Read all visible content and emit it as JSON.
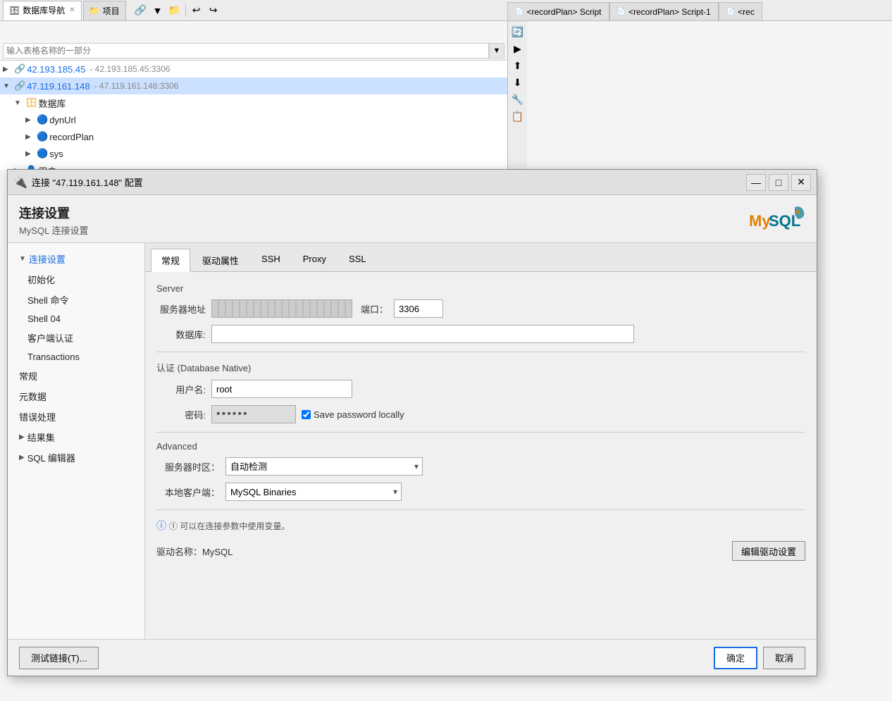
{
  "background": {
    "title": "数据库导航",
    "tabs": [
      {
        "label": "数据库导航",
        "icon": "db"
      },
      {
        "label": "项目",
        "icon": "project"
      }
    ],
    "search_placeholder": "输入表格名称的一部分",
    "tree_items": [
      {
        "id": "t1",
        "indent": 0,
        "arrow": "▶",
        "icon": "🔗",
        "text": "42.193.185.45",
        "sub": "- 42.193.185.45:3306",
        "selected": false
      },
      {
        "id": "t2",
        "indent": 0,
        "arrow": "▼",
        "icon": "🔗",
        "text": "47.119.161.148",
        "sub": "- 47.119.161.148:3306",
        "selected": true
      },
      {
        "id": "t3",
        "indent": 1,
        "arrow": "▼",
        "icon": "🗄",
        "text": "数据库",
        "sub": "",
        "selected": false
      },
      {
        "id": "t4",
        "indent": 2,
        "arrow": "▶",
        "icon": "📂",
        "text": "dynUrl",
        "sub": "",
        "selected": false
      },
      {
        "id": "t5",
        "indent": 2,
        "arrow": "▶",
        "icon": "📂",
        "text": "recordPlan",
        "sub": "",
        "selected": false
      },
      {
        "id": "t6",
        "indent": 2,
        "arrow": "▶",
        "icon": "📂",
        "text": "sys",
        "sub": "",
        "selected": false
      },
      {
        "id": "t7",
        "indent": 1,
        "arrow": "▶",
        "icon": "👤",
        "text": "用户",
        "sub": "",
        "selected": false
      }
    ],
    "script_tabs": [
      {
        "label": "<recordPlan> Script"
      },
      {
        "label": "<recordPlan> Script-1"
      },
      {
        "label": "<rec"
      }
    ]
  },
  "dialog": {
    "title": "连接 \"47.119.161.148\" 配置",
    "title_icon": "🔌",
    "header_title": "连接设置",
    "header_sub": "MySQL 连接设置",
    "mysql_logo": "MySQL",
    "nav_items": [
      {
        "label": "连接设置",
        "indent": 0,
        "arrow": "▼",
        "selected": true,
        "parent": true
      },
      {
        "label": "初始化",
        "indent": 1,
        "selected": false
      },
      {
        "label": "Shell 命令",
        "indent": 1,
        "selected": false
      },
      {
        "label": "Shell 04",
        "indent": 1,
        "selected": false
      },
      {
        "label": "客户端认证",
        "indent": 1,
        "selected": false
      },
      {
        "label": "Transactions",
        "indent": 1,
        "selected": false
      },
      {
        "label": "常规",
        "indent": 0,
        "selected": false
      },
      {
        "label": "元数据",
        "indent": 0,
        "selected": false
      },
      {
        "label": "错误处理",
        "indent": 0,
        "selected": false
      },
      {
        "label": "结果集",
        "indent": 0,
        "arrow": "▶",
        "parent": true,
        "selected": false
      },
      {
        "label": "SQL 编辑器",
        "indent": 0,
        "arrow": "▶",
        "parent": true,
        "selected": false
      }
    ],
    "tabs": [
      {
        "label": "常规",
        "active": true
      },
      {
        "label": "驱动属性",
        "active": false
      },
      {
        "label": "SSH",
        "active": false
      },
      {
        "label": "Proxy",
        "active": false
      },
      {
        "label": "SSL",
        "active": false
      }
    ],
    "server_section": "Server",
    "server_host_label": "服务器地址",
    "server_host_value": "",
    "server_port_label": "端口：",
    "server_port_value": "3306",
    "database_label": "数据库:",
    "database_value": "",
    "auth_section": "认证 (Database Native)",
    "username_label": "用户名:",
    "username_value": "root",
    "password_label": "密码:",
    "save_password_label": "Save password locally",
    "advanced_section": "Advanced",
    "timezone_label": "服务器时区：",
    "timezone_value": "自动检测",
    "local_client_label": "本地客户端：",
    "local_client_value": "MySQL Binaries",
    "info_text": "① 可以在连接参数中使用变量。",
    "driver_label": "驱动名称：MySQL",
    "edit_driver_btn": "编辑驱动设置",
    "footer": {
      "test_btn": "测试链接(T)...",
      "ok_btn": "确定",
      "cancel_btn": "取消"
    },
    "win_minimize": "—",
    "win_restore": "□",
    "win_close": "✕"
  }
}
